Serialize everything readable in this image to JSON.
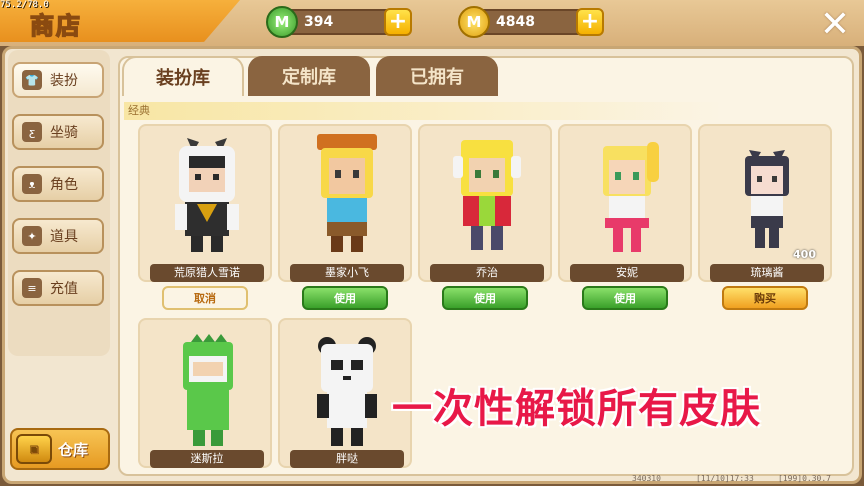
{
  "fps": "75.2/78.0",
  "title": "商店",
  "currency": {
    "gems": "394",
    "coins": "4848",
    "gem_symbol": "M",
    "coin_symbol": "M"
  },
  "sidebar": {
    "items": [
      {
        "label": "装扮",
        "icon": "shirt-icon"
      },
      {
        "label": "坐骑",
        "icon": "wings-icon"
      },
      {
        "label": "角色",
        "icon": "cat-face-icon"
      },
      {
        "label": "道具",
        "icon": "party-popper-icon"
      },
      {
        "label": "充值",
        "icon": "coin-stack-icon"
      }
    ],
    "warehouse": "仓库"
  },
  "tabs": [
    "装扮库",
    "定制库",
    "已拥有"
  ],
  "section": "经典",
  "cards": [
    {
      "name": "荒原猎人雪诺",
      "action": "取消"
    },
    {
      "name": "墨家小飞",
      "action": "使用"
    },
    {
      "name": "乔治",
      "action": "使用"
    },
    {
      "name": "安妮",
      "action": "使用"
    },
    {
      "name": "琉璃酱",
      "action": "购买",
      "price": "400"
    },
    {
      "name": "迷斯拉"
    },
    {
      "name": "胖哒"
    }
  ],
  "promo": "一次性解锁所有皮肤",
  "footer": [
    "340310",
    "[11/10]17:33",
    "[199]0.30.7"
  ],
  "colors": {
    "accent": "#f6b03c",
    "use_green": "#3aa02a",
    "promo_red": "#e81848"
  }
}
